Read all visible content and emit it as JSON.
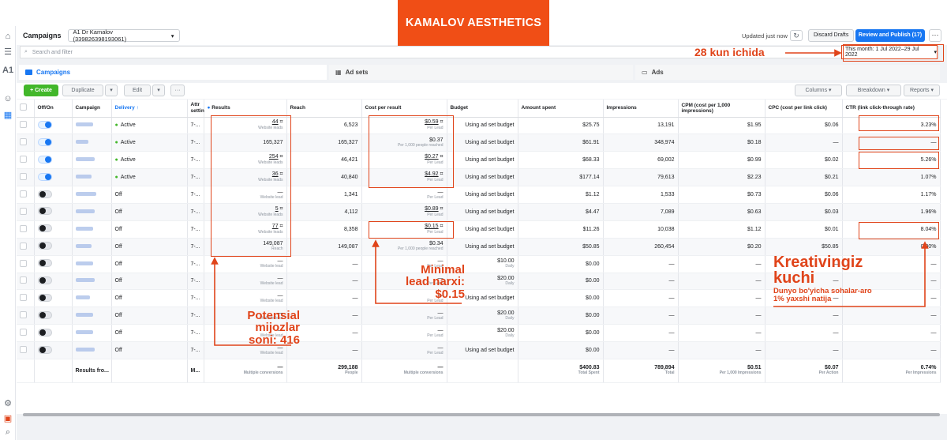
{
  "banner": "KAMALOV AESTHETICS",
  "header": {
    "title": "Campaigns",
    "account": "A1 Dr Kamalov (339826398193061)",
    "updated": "Updated just now",
    "discard": "Discard Drafts",
    "review": "Review and Publish (17)",
    "more": "···"
  },
  "search": {
    "placeholder": "Search and filter",
    "date_range": "This month: 1 Jul 2022–29 Jul 2022"
  },
  "tabs": [
    "Campaigns",
    "Ad sets",
    "Ads"
  ],
  "toolbar": {
    "create": "+ Create",
    "duplicate": "Duplicate",
    "edit": "Edit",
    "columns": "Columns",
    "breakdown": "Breakdown",
    "reports": "Reports"
  },
  "columns": [
    "Off/On",
    "Campaign",
    "Delivery ↑",
    "Attr settin",
    "Results",
    "Reach",
    "Cost per result",
    "Budget",
    "Amount spent",
    "Impressions",
    "CPM (cost per 1,000 impressions)",
    "CPC (cost per link click)",
    "CTR (link click-through rate)"
  ],
  "rows": [
    {
      "on": true,
      "w": 22,
      "delivery": "Active",
      "attr": "7-...",
      "results": "44",
      "rsub": "Website leads",
      "reach": "6,523",
      "cpr": "$0.59",
      "cprsub": "Per Lead",
      "budget": "Using ad set budget",
      "spent": "$25.75",
      "impr": "13,191",
      "cpm": "$1.95",
      "cpc": "$0.06",
      "ctr": "3.23%"
    },
    {
      "on": true,
      "w": 16,
      "delivery": "Active",
      "attr": "7-...",
      "results": "165,327",
      "rsub": "",
      "reach": "165,327",
      "cpr": "$0.37",
      "cprsub": "Per 1,000 people reached",
      "budget": "Using ad set budget",
      "spent": "$61.91",
      "impr": "348,974",
      "cpm": "$0.18",
      "cpc": "—",
      "ctr": "—"
    },
    {
      "on": true,
      "w": 24,
      "delivery": "Active",
      "attr": "7-...",
      "results": "254",
      "rsub": "Website leads",
      "reach": "46,421",
      "cpr": "$0.27",
      "cprsub": "Per Lead",
      "budget": "Using ad set budget",
      "spent": "$68.33",
      "impr": "69,002",
      "cpm": "$0.99",
      "cpc": "$0.02",
      "ctr": "5.26%"
    },
    {
      "on": true,
      "w": 20,
      "delivery": "Active",
      "attr": "7-...",
      "results": "36",
      "rsub": "Website leads",
      "reach": "40,840",
      "cpr": "$4.92",
      "cprsub": "Per Lead",
      "budget": "Using ad set budget",
      "spent": "$177.14",
      "impr": "79,613",
      "cpm": "$2.23",
      "cpc": "$0.21",
      "ctr": "1.07%"
    },
    {
      "on": false,
      "w": 26,
      "delivery": "Off",
      "attr": "7-...",
      "results": "—",
      "rsub": "Website lead",
      "reach": "1,341",
      "cpr": "—",
      "cprsub": "Per Lead",
      "budget": "Using ad set budget",
      "spent": "$1.12",
      "impr": "1,533",
      "cpm": "$0.73",
      "cpc": "$0.06",
      "ctr": "1.17%"
    },
    {
      "on": false,
      "w": 24,
      "delivery": "Off",
      "attr": "7-...",
      "results": "5",
      "rsub": "Website leads",
      "reach": "4,112",
      "cpr": "$0.89",
      "cprsub": "Per Lead",
      "budget": "Using ad set budget",
      "spent": "$4.47",
      "impr": "7,089",
      "cpm": "$0.63",
      "cpc": "$0.03",
      "ctr": "1.96%"
    },
    {
      "on": false,
      "w": 22,
      "delivery": "Off",
      "attr": "7-...",
      "results": "77",
      "rsub": "Website leads",
      "reach": "8,358",
      "cpr": "$0.15",
      "cprsub": "Per Lead",
      "budget": "Using ad set budget",
      "spent": "$11.26",
      "impr": "10,038",
      "cpm": "$1.12",
      "cpc": "$0.01",
      "ctr": "8.04%"
    },
    {
      "on": false,
      "w": 20,
      "delivery": "Off",
      "attr": "7-...",
      "results": "149,087",
      "rsub": "Reach",
      "reach": "149,087",
      "cpr": "$0.34",
      "cprsub": "Per 1,000 people reached",
      "budget": "Using ad set budget",
      "spent": "$50.85",
      "impr": "260,454",
      "cpm": "$0.20",
      "cpc": "$50.85",
      "ctr": "0.00%"
    },
    {
      "on": false,
      "w": 22,
      "delivery": "Off",
      "attr": "7-...",
      "results": "—",
      "rsub": "Website lead",
      "reach": "—",
      "cpr": "—",
      "cprsub": "Per Lead",
      "budget": "$10.00",
      "bsub": "Daily",
      "spent": "$0.00",
      "impr": "—",
      "cpm": "—",
      "cpc": "—",
      "ctr": "—"
    },
    {
      "on": false,
      "w": 24,
      "delivery": "Off",
      "attr": "7-...",
      "results": "—",
      "rsub": "Website lead",
      "reach": "—",
      "cpr": "—",
      "cprsub": "Per Lead",
      "budget": "$20.00",
      "bsub": "Daily",
      "spent": "$0.00",
      "impr": "—",
      "cpm": "—",
      "cpc": "—",
      "ctr": "—"
    },
    {
      "on": false,
      "w": 18,
      "delivery": "Off",
      "attr": "7-...",
      "results": "—",
      "rsub": "Website lead",
      "reach": "—",
      "cpr": "—",
      "cprsub": "Per Lead",
      "budget": "Using ad set budget",
      "spent": "$0.00",
      "impr": "—",
      "cpm": "—",
      "cpc": "—",
      "ctr": "—"
    },
    {
      "on": false,
      "w": 22,
      "delivery": "Off",
      "attr": "7-...",
      "results": "—",
      "rsub": "Website lead",
      "reach": "—",
      "cpr": "—",
      "cprsub": "Per Lead",
      "budget": "$20.00",
      "bsub": "Daily",
      "spent": "$0.00",
      "impr": "—",
      "cpm": "—",
      "cpc": "—",
      "ctr": "—"
    },
    {
      "on": false,
      "w": 22,
      "delivery": "Off",
      "attr": "7-...",
      "results": "—",
      "rsub": "Website lead",
      "reach": "—",
      "cpr": "—",
      "cprsub": "Per Lead",
      "budget": "$20.00",
      "bsub": "Daily",
      "spent": "$0.00",
      "impr": "—",
      "cpm": "—",
      "cpc": "—",
      "ctr": "—"
    },
    {
      "on": false,
      "w": 24,
      "delivery": "Off",
      "attr": "7-...",
      "results": "—",
      "rsub": "Website lead",
      "reach": "—",
      "cpr": "—",
      "cprsub": "Per Lead",
      "budget": "Using ad set budget",
      "spent": "$0.00",
      "impr": "—",
      "cpm": "—",
      "cpc": "—",
      "ctr": "—"
    }
  ],
  "totals": {
    "label": "Results fro...",
    "attr": "M...",
    "results": "—",
    "rsub": "Multiple conversions",
    "reach": "299,188",
    "reachsub": "People",
    "cpr": "—",
    "cprsub": "Multiple conversions",
    "spent": "$400.83",
    "spentsub": "Total Spent",
    "impr": "789,894",
    "imprsub": "Total",
    "cpm": "$0.51",
    "cpmsub": "Per 1,000 Impressions",
    "cpc": "$0.07",
    "cpcsub": "Per Action",
    "ctr": "0.74%",
    "ctrsub": "Per Impressions"
  },
  "annotations": {
    "days": "28 kun ichida",
    "leads": [
      "Potensial",
      "mijozlar",
      "soni: 416"
    ],
    "min": [
      "Minimal",
      "lead narxi:",
      "$0.15"
    ],
    "power": [
      "Kreativingiz",
      "kuchi"
    ],
    "power_sub": [
      "Dunyo bo'yicha sohalar-aro",
      "1% yaxshi natija"
    ]
  },
  "colors": {
    "accent": "#e0441a",
    "banner": "#f04e16",
    "fb_blue": "#1877f2",
    "active": "#42b72a"
  }
}
